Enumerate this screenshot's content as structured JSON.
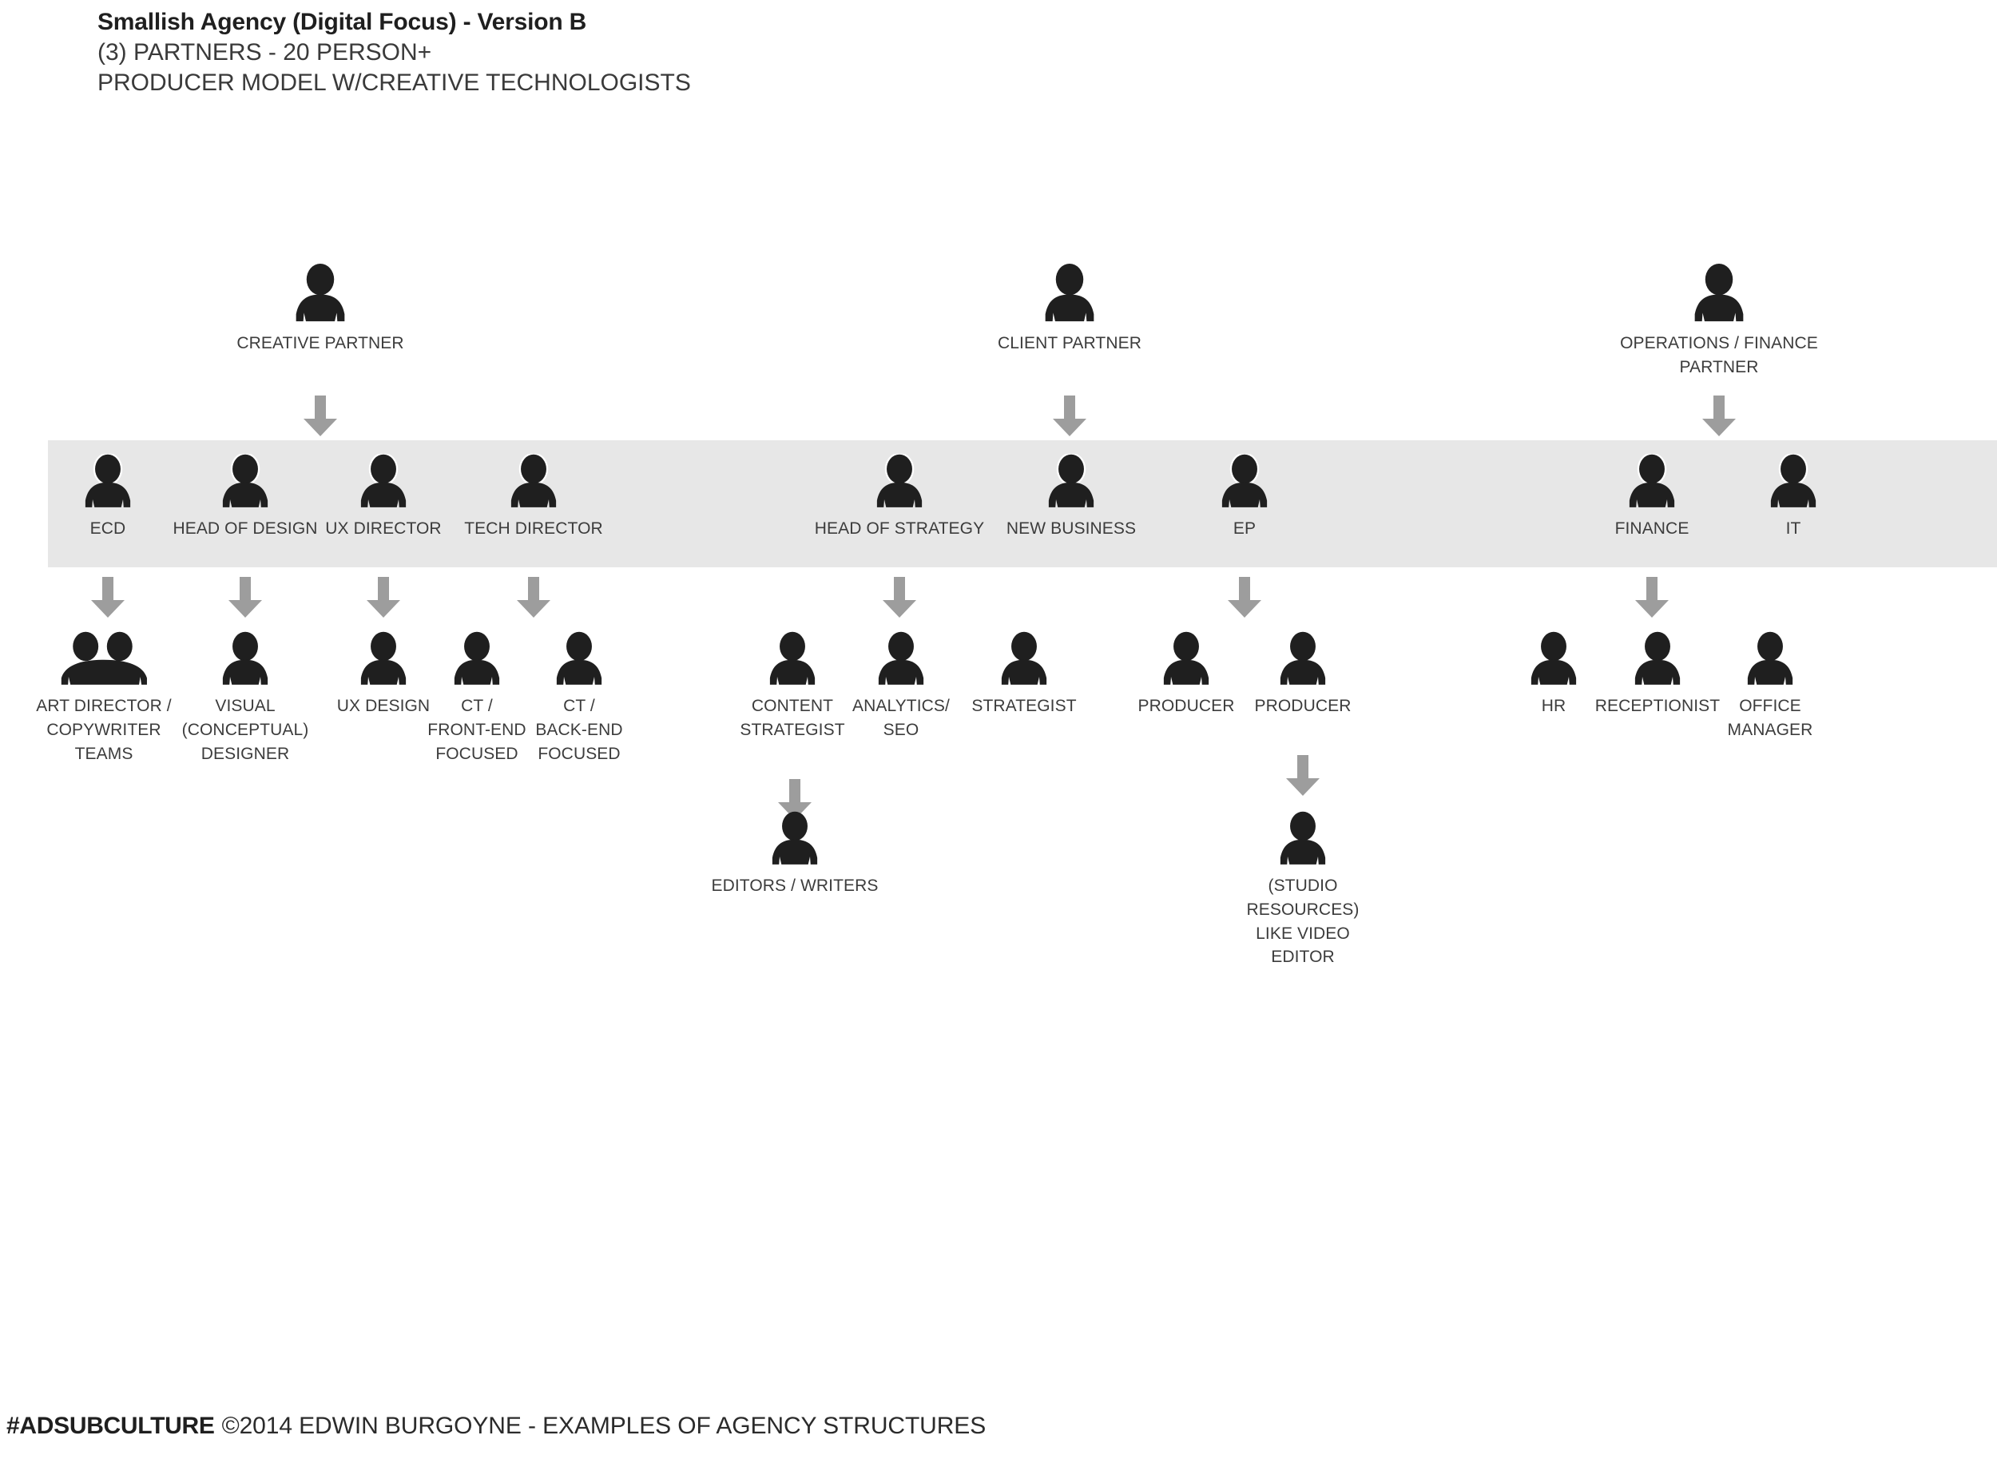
{
  "header": {
    "title": "Smallish Agency (Digital Focus) - Version B",
    "subtitle_1": "(3) PARTNERS - 20 PERSON+",
    "subtitle_2": "PRODUCER MODEL W/CREATIVE TECHNOLOGISTS"
  },
  "footer": {
    "brand": "#ADSUBCULTURE",
    "credit": "©2014 EDWIN BURGOYNE - EXAMPLES OF AGENCY STRUCTURES"
  },
  "colors": {
    "figure": "#1f1f1f",
    "arrow": "#9d9d9d",
    "band": "#e7e7e7",
    "text": "#3c3c3c",
    "title": "#1f1f1f",
    "background": "#ffffff"
  },
  "chart_data": {
    "type": "org-chart",
    "title": "Smallish Agency (Digital Focus) - Version B",
    "levels": [
      "partners",
      "managers",
      "staff",
      "support"
    ],
    "nodes": [
      {
        "id": "creative-partner",
        "label": "CREATIVE PARTNER",
        "level": "partners",
        "icon": "person-single"
      },
      {
        "id": "client-partner",
        "label": "CLIENT PARTNER",
        "level": "partners",
        "icon": "person-single"
      },
      {
        "id": "operations-partner",
        "label": "OPERATIONS / FINANCE PARTNER",
        "level": "partners",
        "icon": "person-single"
      },
      {
        "id": "ecd",
        "label": "ECD",
        "level": "managers",
        "icon": "person-single"
      },
      {
        "id": "head-of-design",
        "label": "HEAD OF DESIGN",
        "level": "managers",
        "icon": "person-single"
      },
      {
        "id": "ux-director",
        "label": "UX DIRECTOR",
        "level": "managers",
        "icon": "person-single"
      },
      {
        "id": "tech-director",
        "label": "TECH DIRECTOR",
        "level": "managers",
        "icon": "person-single"
      },
      {
        "id": "head-of-strategy",
        "label": "HEAD OF STRATEGY",
        "level": "managers",
        "icon": "person-single"
      },
      {
        "id": "new-business",
        "label": "NEW BUSINESS",
        "level": "managers",
        "icon": "person-single"
      },
      {
        "id": "ep",
        "label": "EP",
        "level": "managers",
        "icon": "person-single"
      },
      {
        "id": "finance",
        "label": "FINANCE",
        "level": "managers",
        "icon": "person-single"
      },
      {
        "id": "it",
        "label": "IT",
        "level": "managers",
        "icon": "person-single"
      },
      {
        "id": "art-director-copywriter",
        "label": "ART DIRECTOR / COPYWRITER TEAMS",
        "level": "staff",
        "icon": "person-pair"
      },
      {
        "id": "visual-designer",
        "label": "VISUAL (CONCEPTUAL) DESIGNER",
        "level": "staff",
        "icon": "person-single"
      },
      {
        "id": "ux-design",
        "label": "UX DESIGN",
        "level": "staff",
        "icon": "person-single"
      },
      {
        "id": "ct-front-end",
        "label": "CT / FRONT-END FOCUSED",
        "level": "staff",
        "icon": "person-single"
      },
      {
        "id": "ct-back-end",
        "label": "CT / BACK-END FOCUSED",
        "level": "staff",
        "icon": "person-single"
      },
      {
        "id": "content-strategist",
        "label": "CONTENT STRATEGIST",
        "level": "staff",
        "icon": "person-single"
      },
      {
        "id": "analytics-seo",
        "label": "ANALYTICS/ SEO",
        "level": "staff",
        "icon": "person-single"
      },
      {
        "id": "strategist",
        "label": "STRATEGIST",
        "level": "staff",
        "icon": "person-single"
      },
      {
        "id": "producer-1",
        "label": "PRODUCER",
        "level": "staff",
        "icon": "person-single"
      },
      {
        "id": "producer-2",
        "label": "PRODUCER",
        "level": "staff",
        "icon": "person-single"
      },
      {
        "id": "hr",
        "label": "HR",
        "level": "staff",
        "icon": "person-single"
      },
      {
        "id": "receptionist",
        "label": "RECEPTIONIST",
        "level": "staff",
        "icon": "person-single"
      },
      {
        "id": "office-manager",
        "label": "OFFICE MANAGER",
        "level": "staff",
        "icon": "person-single"
      },
      {
        "id": "editors-writers",
        "label": "EDITORS / WRITERS",
        "level": "support",
        "icon": "person-single"
      },
      {
        "id": "studio-resources",
        "label": "(STUDIO RESOURCES) LIKE VIDEO EDITOR",
        "level": "support",
        "icon": "person-single"
      }
    ],
    "edges": [
      {
        "from": "creative-partner",
        "to": "managers-creative"
      },
      {
        "from": "client-partner",
        "to": "managers-client"
      },
      {
        "from": "operations-partner",
        "to": "managers-operations"
      },
      {
        "from": "ecd",
        "to": "art-director-copywriter"
      },
      {
        "from": "head-of-design",
        "to": "visual-designer"
      },
      {
        "from": "ux-director",
        "to": "ux-design"
      },
      {
        "from": "tech-director",
        "to": "ct-front-end"
      },
      {
        "from": "head-of-strategy",
        "to": "analytics-seo"
      },
      {
        "from": "ep",
        "to": "producer-1"
      },
      {
        "from": "finance",
        "to": "hr"
      },
      {
        "from": "content-strategist",
        "to": "editors-writers"
      },
      {
        "from": "producer-2",
        "to": "studio-resources"
      }
    ]
  },
  "partners": [
    {
      "label_line_1": "CREATIVE PARTNER",
      "label_line_2": ""
    },
    {
      "label_line_1": "CLIENT PARTNER",
      "label_line_2": ""
    },
    {
      "label_line_1": "OPERATIONS / FINANCE",
      "label_line_2": "PARTNER"
    }
  ],
  "managers": [
    {
      "label": "ECD"
    },
    {
      "label": "HEAD OF DESIGN"
    },
    {
      "label": "UX DIRECTOR"
    },
    {
      "label": "TECH DIRECTOR"
    },
    {
      "label": "HEAD OF STRATEGY"
    },
    {
      "label": "NEW BUSINESS"
    },
    {
      "label": "EP"
    },
    {
      "label": "FINANCE"
    },
    {
      "label": "IT"
    }
  ],
  "staff": [
    {
      "line_1": "ART DIRECTOR /",
      "line_2": "COPYWRITER",
      "line_3": "TEAMS"
    },
    {
      "line_1": "VISUAL",
      "line_2": "(CONCEPTUAL)",
      "line_3": "DESIGNER"
    },
    {
      "line_1": "UX DESIGN",
      "line_2": "",
      "line_3": ""
    },
    {
      "line_1": "CT /",
      "line_2": "FRONT-END",
      "line_3": "FOCUSED"
    },
    {
      "line_1": "CT /",
      "line_2": "BACK-END",
      "line_3": "FOCUSED"
    },
    {
      "line_1": "CONTENT",
      "line_2": "STRATEGIST",
      "line_3": ""
    },
    {
      "line_1": "ANALYTICS/",
      "line_2": "SEO",
      "line_3": ""
    },
    {
      "line_1": "STRATEGIST",
      "line_2": "",
      "line_3": ""
    },
    {
      "line_1": "PRODUCER",
      "line_2": "",
      "line_3": ""
    },
    {
      "line_1": "PRODUCER",
      "line_2": "",
      "line_3": ""
    },
    {
      "line_1": "HR",
      "line_2": "",
      "line_3": ""
    },
    {
      "line_1": "RECEPTIONIST",
      "line_2": "",
      "line_3": ""
    },
    {
      "line_1": "OFFICE",
      "line_2": "MANAGER",
      "line_3": ""
    }
  ],
  "support": [
    {
      "line_1": "EDITORS / WRITERS",
      "line_2": "",
      "line_3": "",
      "line_4": ""
    },
    {
      "line_1": "(STUDIO",
      "line_2": "RESOURCES)",
      "line_3": "LIKE VIDEO",
      "line_4": "EDITOR"
    }
  ]
}
